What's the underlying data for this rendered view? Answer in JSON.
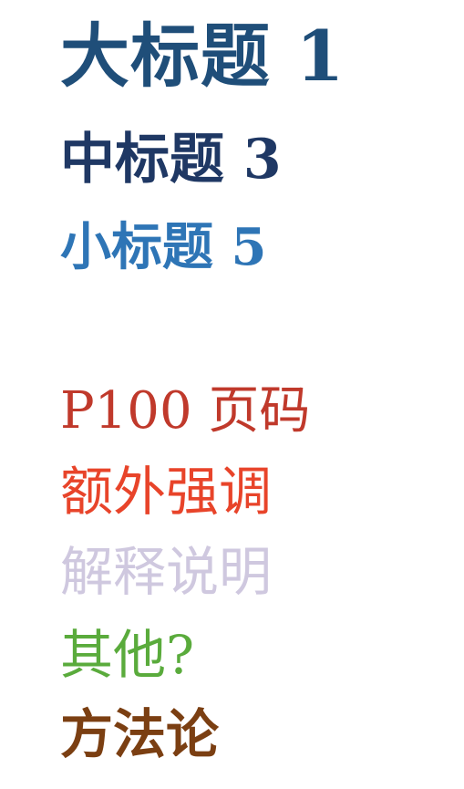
{
  "headings": {
    "large": {
      "text": "大标题 1",
      "color": "#1f4e79"
    },
    "medium": {
      "text": "中标题 3",
      "color": "#1f3864"
    },
    "small": {
      "text": "小标题 5",
      "color": "#2e75b6"
    }
  },
  "items": [
    {
      "text": "P100 页码",
      "color": "#c0392b"
    },
    {
      "text": "额外强调",
      "color": "#e8442a"
    },
    {
      "text": "解释说明",
      "color": "#cfc8df"
    },
    {
      "text": "其他?",
      "color": "#5aab3c"
    },
    {
      "text": "方法论",
      "color": "#7b3f12"
    }
  ]
}
